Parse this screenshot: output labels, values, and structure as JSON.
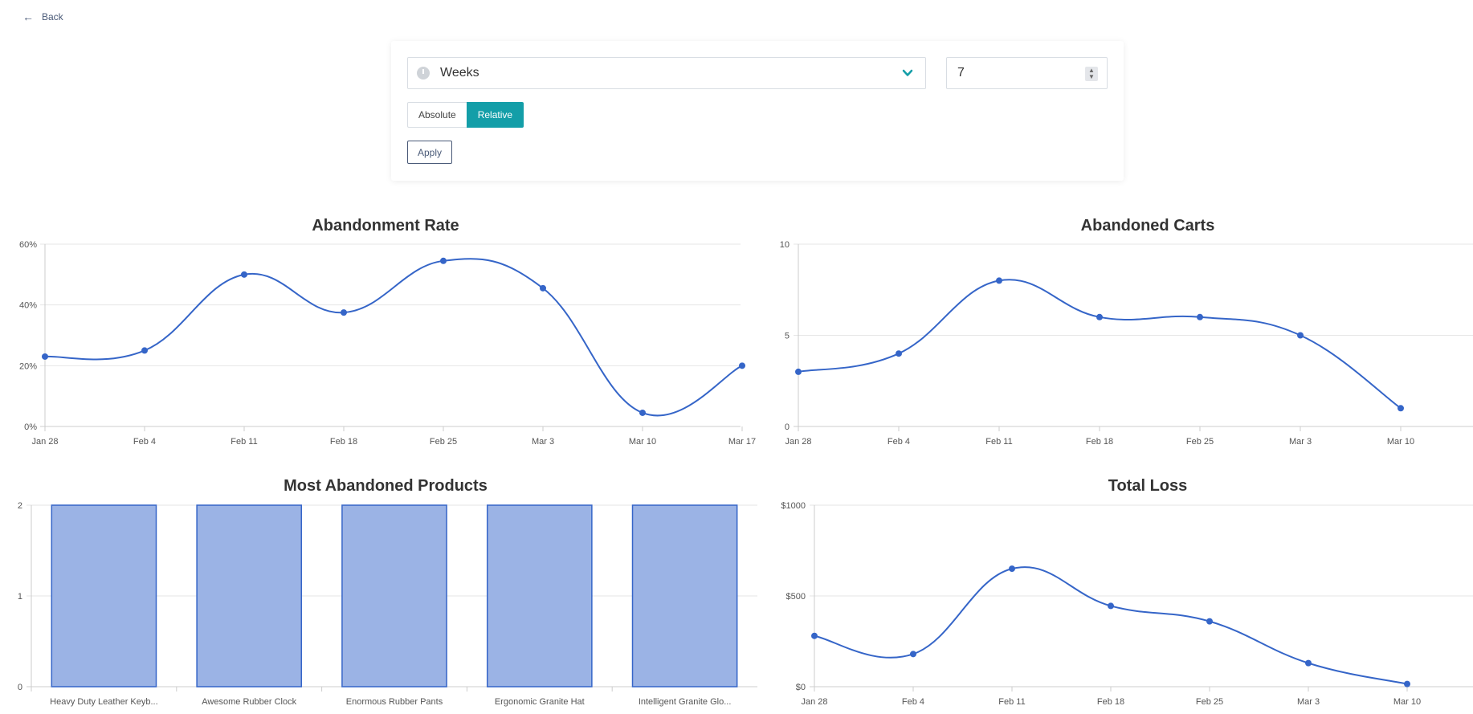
{
  "nav": {
    "back_label": "Back"
  },
  "filters": {
    "period": "Weeks",
    "count": "7",
    "mode_absolute": "Absolute",
    "mode_relative": "Relative",
    "apply_label": "Apply"
  },
  "colors": {
    "line": "#3565c8",
    "bar_fill": "#9bb3e5",
    "bar_stroke": "#3565c8",
    "accent": "#139ea8",
    "grid": "#e6e6e6"
  },
  "chart_data": [
    {
      "type": "line",
      "title": "Abandonment Rate",
      "x": [
        "Jan 28",
        "Feb 4",
        "Feb 11",
        "Feb 18",
        "Feb 25",
        "Mar 3",
        "Mar 10",
        "Mar 17"
      ],
      "series": [
        {
          "values": [
            23,
            25,
            50,
            37.5,
            54.5,
            45.5,
            4.5,
            20
          ]
        }
      ],
      "yticks": [
        "0%",
        "20%",
        "40%",
        "60%"
      ],
      "ylim": [
        0,
        60
      ]
    },
    {
      "type": "line",
      "title": "Abandoned Carts",
      "x": [
        "Jan 28",
        "Feb 4",
        "Feb 11",
        "Feb 18",
        "Feb 25",
        "Mar 3",
        "Mar 10"
      ],
      "series": [
        {
          "values": [
            3,
            4,
            8,
            6,
            6,
            5,
            1
          ]
        }
      ],
      "yticks": [
        "0",
        "5",
        "10"
      ],
      "ylim": [
        0,
        10
      ]
    },
    {
      "type": "bar",
      "title": "Most Abandoned Products",
      "categories": [
        "Heavy Duty Leather Keyb...",
        "Awesome Rubber Clock",
        "Enormous Rubber Pants",
        "Ergonomic Granite Hat",
        "Intelligent Granite Glo..."
      ],
      "values": [
        2,
        2,
        2,
        2,
        2
      ],
      "yticks": [
        "0",
        "1",
        "2"
      ],
      "ylim": [
        0,
        2
      ]
    },
    {
      "type": "line",
      "title": "Total Loss",
      "x": [
        "Jan 28",
        "Feb 4",
        "Feb 11",
        "Feb 18",
        "Feb 25",
        "Mar 3",
        "Mar 10"
      ],
      "series": [
        {
          "values": [
            280,
            180,
            650,
            445,
            360,
            130,
            15
          ]
        }
      ],
      "yticks": [
        "$0",
        "$500",
        "$1000"
      ],
      "ylim": [
        0,
        1000
      ]
    }
  ]
}
